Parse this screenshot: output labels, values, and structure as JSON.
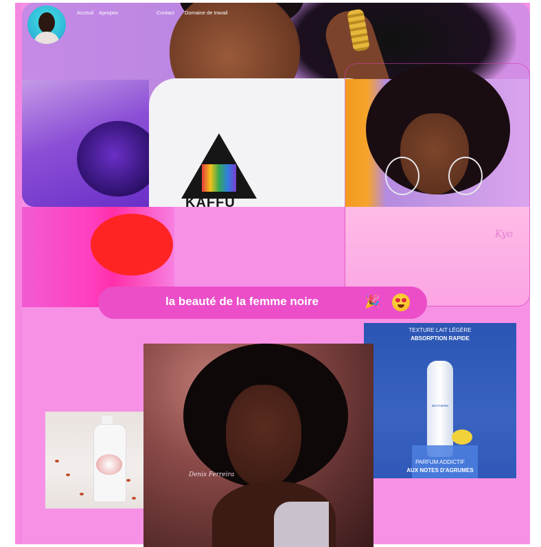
{
  "nav": {
    "items": [
      {
        "label": "Acceuil"
      },
      {
        "label": "Apropos"
      },
      {
        "label": "Contact"
      },
      {
        "label": "Domaine de travail"
      }
    ]
  },
  "banner": {
    "title": "la beauté de la femme  noire",
    "party_icon": "🎉",
    "emoji_icon": "heart-eyes-emoji"
  },
  "hero": {
    "shirt_text": "KAFFU"
  },
  "ads": {
    "biotherm": {
      "line1": "TEXTURE LAIT LÉGÈRE",
      "line2": "ABSORPTION RAPIDE",
      "line3": "PARFUM ADDICTIF",
      "line4": "AUX NOTES D'AGRUMES",
      "brand": "BIOTHERM"
    }
  },
  "colors": {
    "page_background": "#f791e6",
    "pill": "#eb4ec8",
    "nav_text": "#ffffff"
  }
}
